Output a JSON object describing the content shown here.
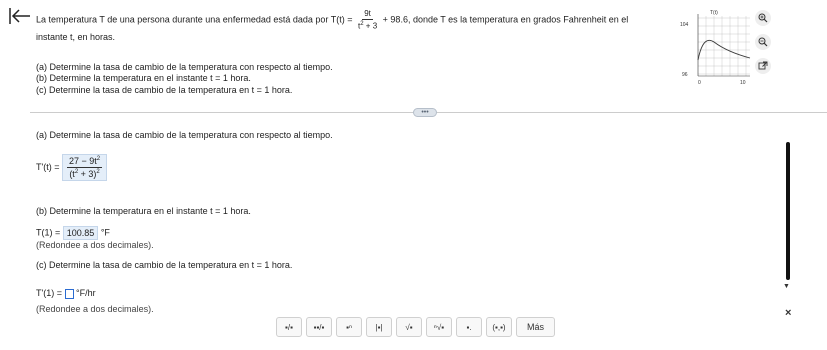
{
  "problem": {
    "stmt_a": "La temperatura T de una persona durante una enfermedad está dada por",
    "func_lhs": "T(t) =",
    "frac_num": "9t",
    "frac_den_base": "t",
    "frac_den_exp": "2",
    "frac_den_tail": " + 3",
    "stmt_b": "+ 98.6, donde T es la temperatura en grados Fahrenheit en el",
    "stmt_c": "instante t, en horas.",
    "part_a": "(a) Determine la tasa de cambio de la temperatura con respecto al tiempo.",
    "part_b": "(b) Determine la temperatura en el instante t = 1 hora.",
    "part_c": "(c) Determine la tasa de cambio de la temperatura en t = 1 hora."
  },
  "graph": {
    "y_label": "T(t)",
    "y_top": "104",
    "y_bottom": "96",
    "x_left": "0",
    "x_right": "10"
  },
  "answers": {
    "a_heading": "(a) Determine la tasa de cambio de la temperatura con respecto al tiempo.",
    "a_lhs": "T'(t) =",
    "a_num": "27 − 9t",
    "a_num_exp": "2",
    "a_den_base": "(t",
    "a_den_exp1": "2",
    "a_den_mid": " + 3)",
    "a_den_exp2": "2",
    "b_heading": "(b) Determine la temperatura en el instante t = 1 hora.",
    "b_lhs": "T(1) =",
    "b_value": "100.85",
    "b_unit": "°F",
    "b_hint": "(Redondee a dos decimales).",
    "c_heading": "(c) Determine la tasa de cambio de la temperatura en t = 1 hora.",
    "c_lhs": "T'(1) =",
    "c_unit": "°F/hr",
    "c_hint": "(Redondee a dos decimales)."
  },
  "toolbar": {
    "buttons": [
      "▪/▪",
      "▪▪/▪",
      "▪ⁿ",
      "|▪|",
      "√▪",
      "ⁿ√▪",
      "▪.",
      "(▪,▪)"
    ],
    "mas": "Más"
  },
  "ui": {
    "dots": "•••",
    "close": "×",
    "scroll_down": "▼"
  }
}
